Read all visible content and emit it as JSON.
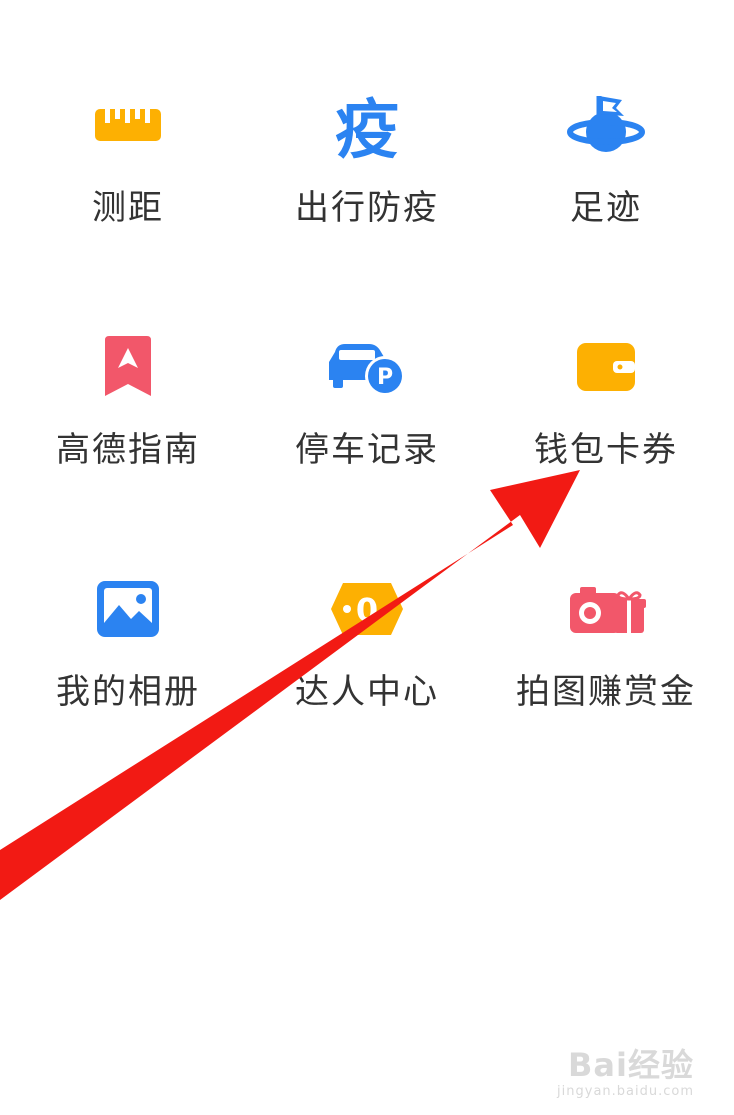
{
  "grid": {
    "items": [
      {
        "label": "测距",
        "icon": "ruler-icon"
      },
      {
        "label": "出行防疫",
        "icon": "epidemic-icon",
        "glyph": "疫"
      },
      {
        "label": "足迹",
        "icon": "footprint-globe-icon"
      },
      {
        "label": "高德指南",
        "icon": "guide-bookmark-icon"
      },
      {
        "label": "停车记录",
        "icon": "parking-car-icon",
        "glyph": "P"
      },
      {
        "label": "钱包卡券",
        "icon": "wallet-icon"
      },
      {
        "label": "我的相册",
        "icon": "photo-album-icon"
      },
      {
        "label": "达人中心",
        "icon": "expert-center-icon",
        "glyph": "0"
      },
      {
        "label": "拍图赚赏金",
        "icon": "camera-gift-icon"
      }
    ]
  },
  "colors": {
    "yellow": "#FDB002",
    "blue": "#2B83F1",
    "pink": "#F2576A",
    "arrow_red": "#F21A14",
    "text": "#333333"
  },
  "watermark": {
    "brand": "Bai经验",
    "url": "jingyan.baidu.com"
  }
}
